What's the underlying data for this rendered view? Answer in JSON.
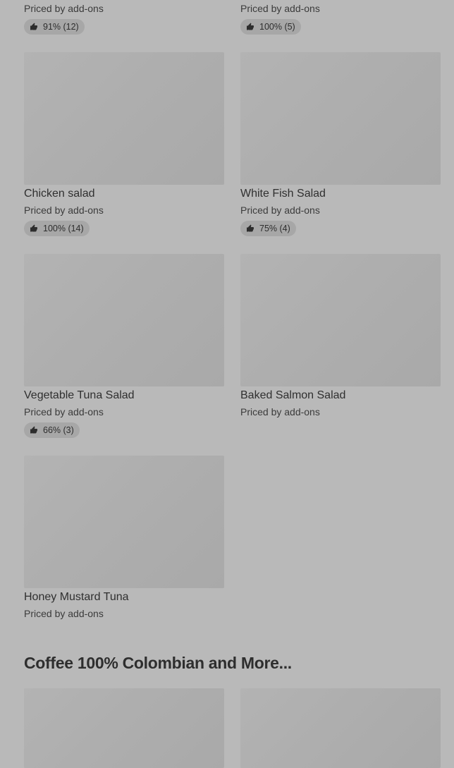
{
  "top_row": [
    {
      "price": "Priced by add-ons",
      "rating": "91% (12)"
    },
    {
      "price": "Priced by add-ons",
      "rating": "100% (5)"
    }
  ],
  "items": [
    {
      "name": "Chicken salad",
      "price": "Priced by add-ons",
      "rating": "100% (14)"
    },
    {
      "name": "White Fish Salad",
      "price": "Priced by add-ons",
      "rating": "75% (4)"
    },
    {
      "name": "Vegetable Tuna Salad",
      "price": "Priced by add-ons",
      "rating": "66% (3)"
    },
    {
      "name": "Baked Salmon Salad",
      "price": "Priced by add-ons",
      "rating": ""
    },
    {
      "name": "Honey Mustard Tuna",
      "price": "Priced by add-ons",
      "rating": ""
    }
  ],
  "section": {
    "title": "Coffee 100% Colombian and More..."
  },
  "icons": {
    "rating": "thumbs-up-icon"
  }
}
